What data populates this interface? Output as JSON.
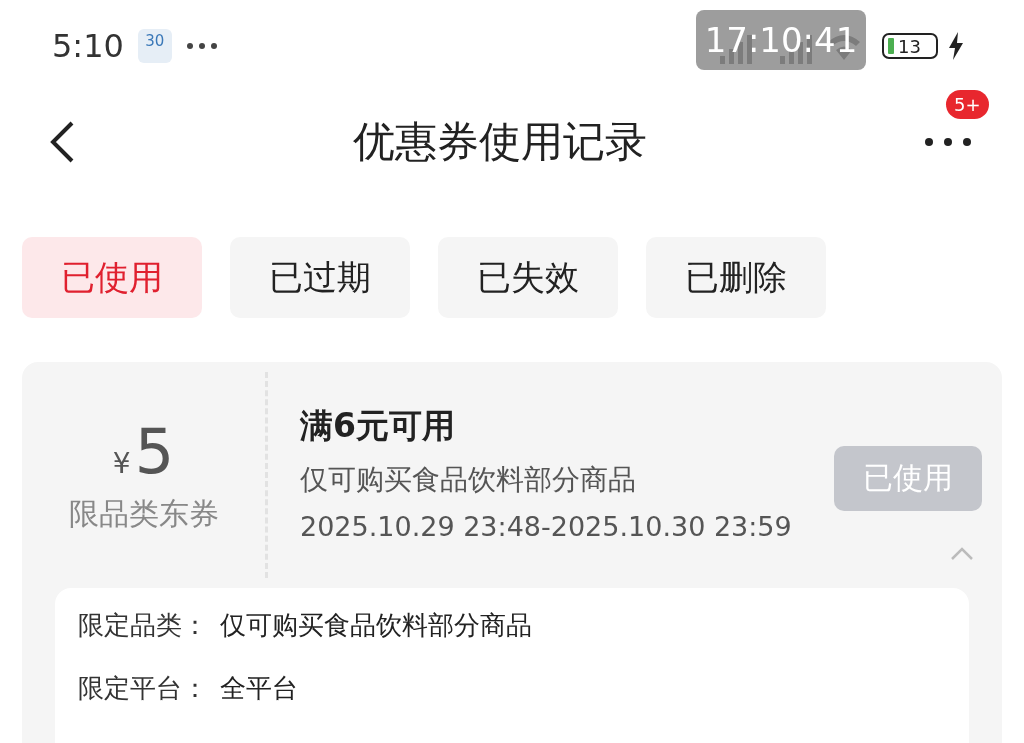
{
  "status_bar": {
    "time": "5:10",
    "calendar_day": "30",
    "recording_clock": "17:10:41",
    "battery": "13",
    "charging": true
  },
  "header": {
    "title": "优惠券使用记录",
    "badge": "5+"
  },
  "tabs": [
    {
      "label": "已使用",
      "selected": true
    },
    {
      "label": "已过期",
      "selected": false
    },
    {
      "label": "已失效",
      "selected": false
    },
    {
      "label": "已删除",
      "selected": false
    }
  ],
  "coupon": {
    "currency": "¥",
    "amount": "5",
    "type": "限品类东券",
    "condition": "满6元可用",
    "scope": "仅可购买食品饮料部分商品",
    "period": "2025.10.29 23:48-2025.10.30 23:59",
    "status_button": "已使用",
    "used": true,
    "expanded": true,
    "details": [
      {
        "label": "限定品类：",
        "value": "仅可购买食品饮料部分商品"
      },
      {
        "label": "限定平台：",
        "value": "全平台"
      }
    ]
  }
}
